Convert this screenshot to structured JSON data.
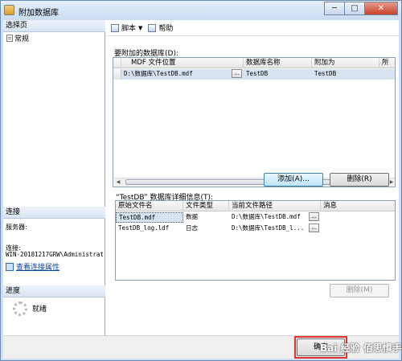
{
  "window": {
    "title": "附加数据库",
    "minimize": "─",
    "maximize": "□",
    "close": "✕"
  },
  "left": {
    "select_page_header": "选择页",
    "nav_item": "常规",
    "connection_header": "连接",
    "server_label": "服务器:",
    "connection_label": "连接:",
    "connection_value": "WIN-20181217GRW\\Administrat",
    "view_connection_link": "查看连接属性",
    "progress_header": "进度",
    "progress_status": "就绪"
  },
  "toolbar": {
    "script": "脚本",
    "help": "帮助"
  },
  "attach": {
    "section_label": "要附加的数据库(D):",
    "columns": [
      "MDF 文件位置",
      "数据库名称",
      "附加为",
      "所"
    ],
    "rows": [
      {
        "mdf": "D:\\数据库\\TestDB.mdf",
        "ellipsis": "...",
        "dbname": "TestDB",
        "attach_as": "TestDB"
      }
    ],
    "add_button": "添加(A)...",
    "remove_button": "删除(R)"
  },
  "details": {
    "section_label": "“TestDB” 数据库详细信息(T):",
    "columns": [
      "原始文件名",
      "文件类型",
      "当前文件路径",
      "消息"
    ],
    "rows": [
      {
        "name": "TestDB.mdf",
        "type": "数据",
        "path": "D:\\数据库\\TestDB.mdf",
        "ellipsis": "...",
        "message": ""
      },
      {
        "name": "TestDB_log.ldf",
        "type": "日志",
        "path": "D:\\数据库\\TestDB_l...",
        "ellipsis": "...",
        "message": ""
      }
    ],
    "remove_button": "删除(M)"
  },
  "bottom": {
    "ok_button": "确定",
    "watermark": "Bai 经验  佰思惧手设"
  }
}
